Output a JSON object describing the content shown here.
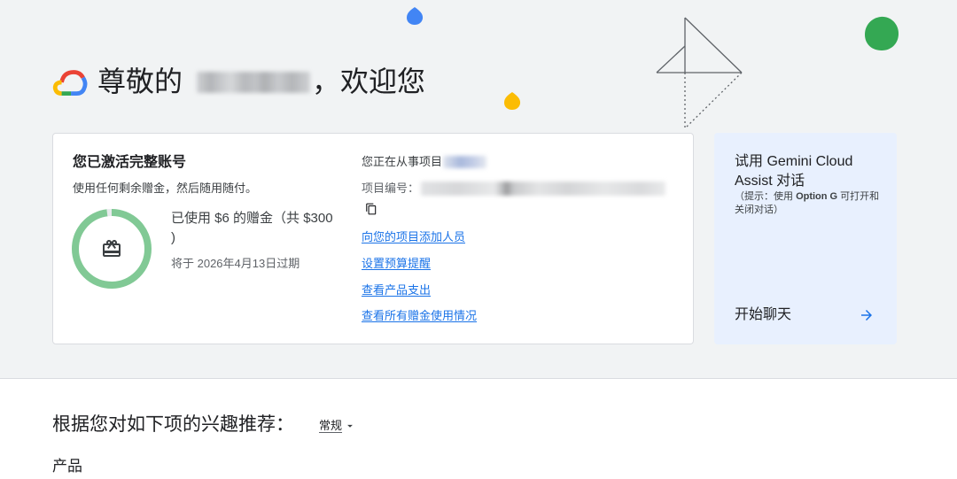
{
  "header": {
    "greeting_prefix": "尊敬的",
    "greeting_suffix": "，欢迎您"
  },
  "account_card": {
    "title": "您已激活完整账号",
    "subtitle": "使用任何剩余赠金，然后随用随付。",
    "credit_line1": "已使用 $6 的赠金（共 $300",
    "credit_line2": ")",
    "expiry": "将于 2026年4月13日过期",
    "credit": {
      "used": 6,
      "total": 300
    }
  },
  "project": {
    "working_on_label": "您正在从事项目",
    "project_number_label": "项目编号：",
    "links": [
      {
        "label": "向您的项目添加人员"
      },
      {
        "label": "设置预算提醒"
      },
      {
        "label": "查看产品支出"
      },
      {
        "label": "查看所有赠金使用情况"
      }
    ]
  },
  "gemini_card": {
    "title_line1": "试用 Gemini Cloud",
    "title_line2": "Assist 对话",
    "hint_prefix": "（提示：使用 ",
    "hint_key": "Option G",
    "hint_suffix": " 可打开和",
    "hint_line2": "关闭对话）",
    "action_label": "开始聊天"
  },
  "recommendations": {
    "heading": "根据您对如下项的兴趣推荐：",
    "filter_value": "常规",
    "section_title": "产品"
  },
  "icons": {
    "logo": "google-cloud-logo",
    "gift": "redeem-icon",
    "copy": "copy-icon",
    "arrow": "arrow-right-icon",
    "dropdown": "caret-down-icon"
  },
  "colors": {
    "accent": "#1a73e8",
    "credit_remaining": "#81c995",
    "credit_used": "#e8eaed",
    "gemini_card_bg": "#e8f0fe",
    "hero_bg": "#f1f3f4"
  }
}
